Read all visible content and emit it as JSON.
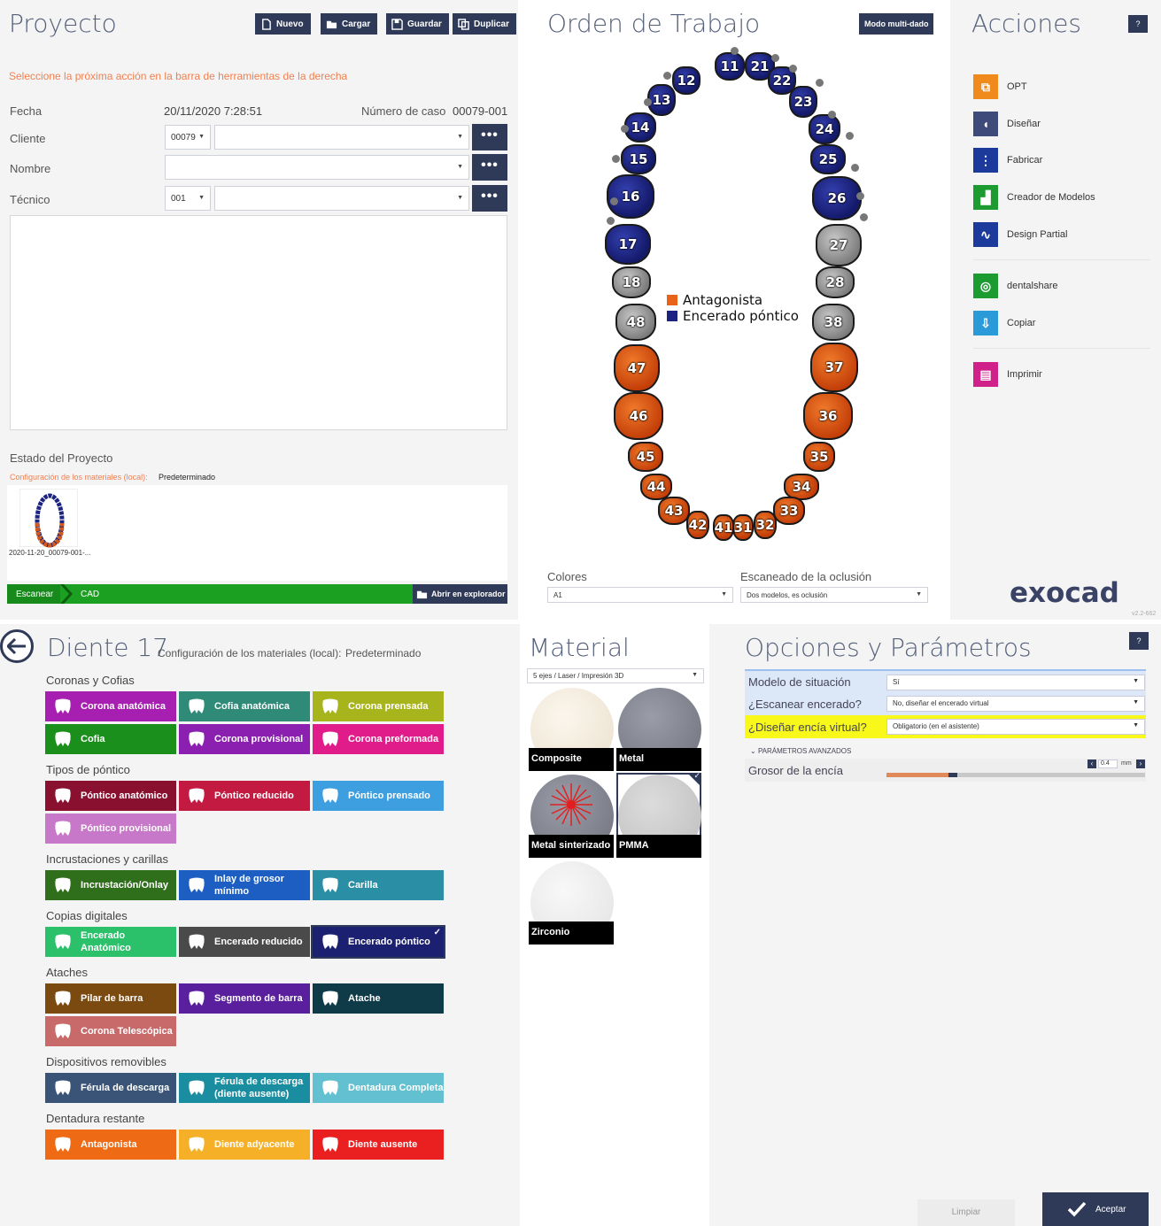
{
  "project": {
    "title": "Proyecto",
    "toolbar": {
      "new": "Nuevo",
      "load": "Cargar",
      "save": "Guardar",
      "duplicate": "Duplicar"
    },
    "hint": "Seleccione la próxima acción en la barra de herramientas de la derecha",
    "date_label": "Fecha",
    "date_value": "20/11/2020  7:28:51",
    "case_label": "Número de caso",
    "case_value": "00079-001",
    "client_label": "Cliente",
    "client_code": "00079",
    "name_label": "Nombre",
    "tech_label": "Técnico",
    "tech_code": "001",
    "dots": "•••",
    "status_title": "Estado del Proyecto",
    "config_label": "Configuración de los materiales (local):",
    "config_value": "Predeterminado",
    "thumb_caption": "2020-11-20_00079-001-...",
    "workflow": {
      "step1": "Escanear",
      "step2": "CAD",
      "open_explorer": "Abrir en explorador"
    }
  },
  "work_order": {
    "title": "Orden de Trabajo",
    "multi_die": "Modo multi-dado",
    "legend": [
      {
        "label": "Antagonista",
        "color": "#e8621a"
      },
      {
        "label": "Encerado póntico",
        "color": "#1c2380"
      }
    ],
    "teeth": [
      {
        "n": "11",
        "s": "blue"
      },
      {
        "n": "21",
        "s": "blue"
      },
      {
        "n": "12",
        "s": "blue"
      },
      {
        "n": "22",
        "s": "blue"
      },
      {
        "n": "13",
        "s": "blue"
      },
      {
        "n": "23",
        "s": "blue"
      },
      {
        "n": "14",
        "s": "blue"
      },
      {
        "n": "24",
        "s": "blue"
      },
      {
        "n": "15",
        "s": "blue"
      },
      {
        "n": "25",
        "s": "blue"
      },
      {
        "n": "16",
        "s": "blue"
      },
      {
        "n": "26",
        "s": "blue"
      },
      {
        "n": "17",
        "s": "blue"
      },
      {
        "n": "27",
        "s": "gray"
      },
      {
        "n": "18",
        "s": "gray"
      },
      {
        "n": "28",
        "s": "gray"
      },
      {
        "n": "48",
        "s": "gray"
      },
      {
        "n": "38",
        "s": "gray"
      },
      {
        "n": "47",
        "s": "orange"
      },
      {
        "n": "37",
        "s": "orange"
      },
      {
        "n": "46",
        "s": "orange"
      },
      {
        "n": "36",
        "s": "orange"
      },
      {
        "n": "45",
        "s": "orange"
      },
      {
        "n": "35",
        "s": "orange"
      },
      {
        "n": "44",
        "s": "orange"
      },
      {
        "n": "34",
        "s": "orange"
      },
      {
        "n": "43",
        "s": "orange"
      },
      {
        "n": "33",
        "s": "orange"
      },
      {
        "n": "42",
        "s": "orange"
      },
      {
        "n": "41",
        "s": "orange"
      },
      {
        "n": "31",
        "s": "orange"
      },
      {
        "n": "32",
        "s": "orange"
      }
    ],
    "colors_label": "Colores",
    "colors_value": "A1",
    "occlusion_label": "Escaneado de la oclusión",
    "occlusion_value": "Dos modelos, es oclusión"
  },
  "actions": {
    "title": "Acciones",
    "help": "?",
    "items": [
      {
        "label": "OPT",
        "icon": "opt-icon",
        "color": "#f08a1c"
      },
      {
        "label": "Diseñar",
        "icon": "design-icon",
        "color": "#3d4a7a"
      },
      {
        "label": "Fabricar",
        "icon": "fabricate-icon",
        "color": "#1c3a9c"
      },
      {
        "label": "Creador de Modelos",
        "icon": "model-creator-icon",
        "color": "#1c9c30"
      },
      {
        "label": "Design Partial",
        "icon": "design-partial-icon",
        "color": "#1c3a9c"
      },
      {
        "label": "dentalshare",
        "icon": "dentalshare-icon",
        "color": "#1c9c30"
      },
      {
        "label": "Copiar",
        "icon": "copy-icon",
        "color": "#2a9ad8"
      },
      {
        "label": "Imprimir",
        "icon": "print-icon",
        "color": "#d0208a"
      }
    ],
    "brand": "exocad",
    "version": "v2.2-662"
  },
  "tooth": {
    "title": "Diente 17",
    "config_label": "Configuración de los materiales (local):",
    "config_value": "Predeterminado",
    "sections": [
      {
        "title": "Coronas y Cofias",
        "items": [
          {
            "label": "Corona anatómica",
            "color": "#a61fb0"
          },
          {
            "label": "Cofia anatómica",
            "color": "#2f8a78"
          },
          {
            "label": "Corona prensada",
            "color": "#a7b41c"
          },
          {
            "label": "Cofia",
            "color": "#1b8f1c"
          },
          {
            "label": "Corona provisional",
            "color": "#8a1fb0"
          },
          {
            "label": "Corona preformada",
            "color": "#e01c8a"
          }
        ]
      },
      {
        "title": "Tipos de póntico",
        "items": [
          {
            "label": "Póntico anatómico",
            "color": "#8a1030"
          },
          {
            "label": "Póntico reducido",
            "color": "#c21a40"
          },
          {
            "label": "Póntico prensado",
            "color": "#3d9ee0"
          },
          {
            "label": "Póntico provisional",
            "color": "#c878c8"
          }
        ]
      },
      {
        "title": "Incrustaciones y carillas",
        "items": [
          {
            "label": "Incrustación/Onlay",
            "color": "#2f6e1a"
          },
          {
            "label": "Inlay de grosor mínimo",
            "color": "#1c5ec2"
          },
          {
            "label": "Carilla",
            "color": "#2a8ea4"
          }
        ]
      },
      {
        "title": "Copias digitales",
        "items": [
          {
            "label": "Encerado Anatómico",
            "color": "#2bc06a"
          },
          {
            "label": "Encerado reducido",
            "color": "#4a4a4a"
          },
          {
            "label": "Encerado póntico",
            "color": "#1c2070"
          }
        ]
      },
      {
        "title": "Ataches",
        "items": [
          {
            "label": "Pilar de barra",
            "color": "#7a4a10"
          },
          {
            "label": "Segmento de barra",
            "color": "#5a1f9c"
          },
          {
            "label": "Atache",
            "color": "#0f3a48"
          },
          {
            "label": "Corona Telescópica",
            "color": "#c86a6a"
          }
        ]
      },
      {
        "title": "Dispositivos removibles",
        "items": [
          {
            "label": "Férula de descarga",
            "color": "#3a5478"
          },
          {
            "label": "Férula de descarga (diente ausente)",
            "color": "#1a8ea0"
          },
          {
            "label": "Dentadura Completa",
            "color": "#62c0d0"
          }
        ]
      },
      {
        "title": "Dentadura restante",
        "items": [
          {
            "label": "Antagonista",
            "color": "#ef6a14"
          },
          {
            "label": "Diente adyacente",
            "color": "#f6b028"
          },
          {
            "label": "Diente ausente",
            "color": "#ea2020"
          }
        ]
      }
    ]
  },
  "material": {
    "title": "Material",
    "machine": "5 ejes / Laser / Impresión 3D",
    "items": [
      {
        "label": "Composite",
        "color": "#f3ebdd"
      },
      {
        "label": "Metal",
        "color": "#8a8c98"
      },
      {
        "label": "Metal sinterizado",
        "color": "#8a8c98"
      },
      {
        "label": "PMMA",
        "color": "#cfcfcf"
      },
      {
        "label": "Zirconio",
        "color": "#f0f0f0"
      }
    ]
  },
  "options": {
    "title": "Opciones y Parámetros",
    "help": "?",
    "rows": [
      {
        "label": "Modelo de situación",
        "value": "Sí"
      },
      {
        "label": "¿Escanear encerado?",
        "value": "No, diseñar el encerado virtual"
      },
      {
        "label": "¿Diseñar encía virtual?",
        "value": "Obligatorio (en el asistente)"
      }
    ],
    "advanced": "PARÁMETROS AVANZADOS",
    "gum_label": "Grosor de la encía",
    "gum_value": "0.4",
    "gum_unit": "mm",
    "clear": "Limpiar",
    "accept": "Aceptar"
  }
}
